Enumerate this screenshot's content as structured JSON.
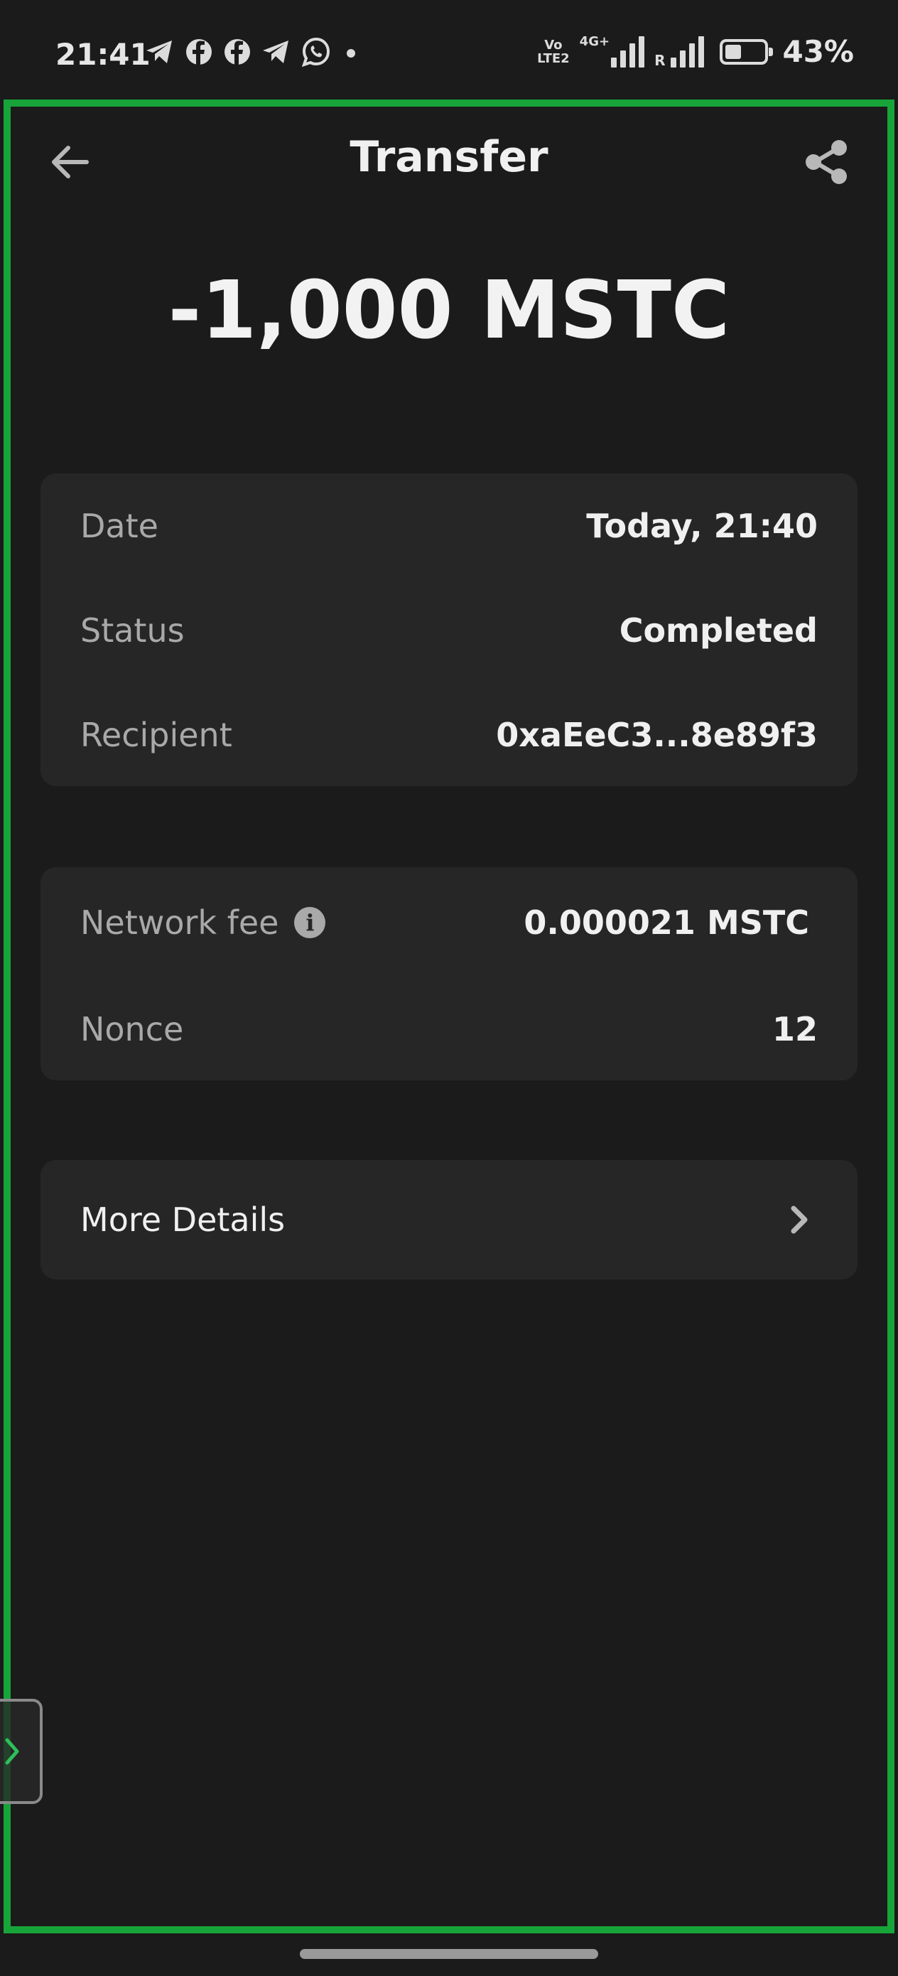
{
  "status_bar": {
    "time": "21:41",
    "notification_icons": [
      "telegram-icon",
      "facebook-icon",
      "facebook-icon",
      "telegram-icon",
      "whatsapp-icon",
      "dot-icon"
    ],
    "volte_line1": "Vo",
    "volte_line2": "LTE2",
    "network_type": "4G+",
    "roaming": "R",
    "battery_percent": "43%",
    "battery_level": 0.43
  },
  "header": {
    "title": "Transfer",
    "back_icon": "arrow-left-icon",
    "share_icon": "share-icon"
  },
  "amount": "-1,000 MSTC",
  "details": [
    {
      "label": "Date",
      "value": "Today, 21:40"
    },
    {
      "label": "Status",
      "value": "Completed"
    },
    {
      "label": "Recipient",
      "value": "0xaEeC3...8e89f3"
    }
  ],
  "fees": [
    {
      "label": "Network fee",
      "value": "0.000021 MSTC",
      "info_icon": "i"
    },
    {
      "label": "Nonce",
      "value": "12"
    }
  ],
  "more_details": {
    "label": "More Details",
    "icon": "chevron-right-icon"
  },
  "colors": {
    "background": "#1b1b1b",
    "card": "#262626",
    "frame_accent": "#17a53a",
    "label": "#a9a9a9",
    "text": "#f0f0f0"
  }
}
